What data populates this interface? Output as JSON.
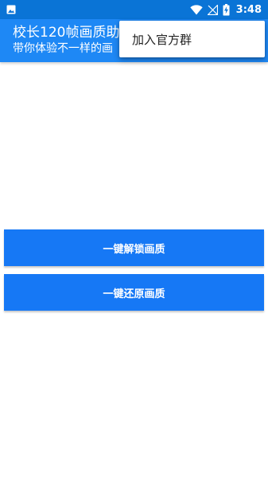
{
  "status_bar": {
    "time": "3:48",
    "icons": [
      "image-notification-icon",
      "wifi-icon",
      "signal-icon",
      "battery-charging-icon"
    ]
  },
  "app_bar": {
    "title": "校长120帧画质助",
    "subtitle": "带你体验不一样的画"
  },
  "popup_menu": {
    "items": [
      {
        "label": "加入官方群"
      }
    ]
  },
  "main": {
    "unlock_button_label": "一键解锁画质",
    "restore_button_label": "一键还原画质"
  },
  "colors": {
    "status_bar": "#0a74d6",
    "app_bar": "#1e88f5",
    "button": "#1678f5",
    "background": "#ffffff"
  }
}
